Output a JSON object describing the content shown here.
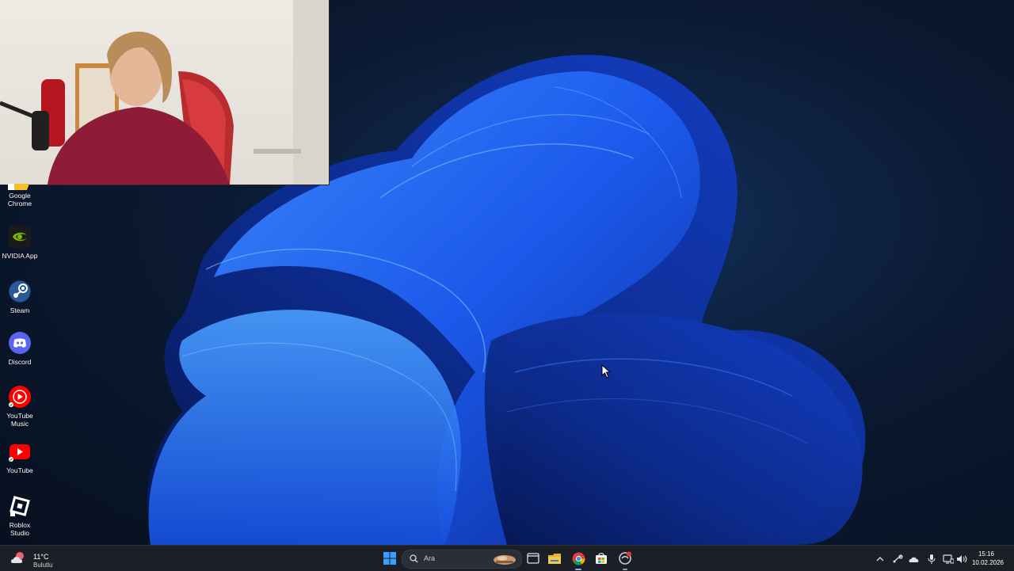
{
  "desktop": {
    "icons": [
      {
        "label_line1": "Google",
        "label_line2": "Chrome",
        "icon": "chrome-icon"
      },
      {
        "label_line1": "NVIDIA App",
        "label_line2": "",
        "icon": "nvidia-icon"
      },
      {
        "label_line1": "Steam",
        "label_line2": "",
        "icon": "steam-icon"
      },
      {
        "label_line1": "Discord",
        "label_line2": "",
        "icon": "discord-icon"
      },
      {
        "label_line1": "YouTube",
        "label_line2": "Music",
        "icon": "youtube-music-icon"
      },
      {
        "label_line1": "YouTube",
        "label_line2": "",
        "icon": "youtube-icon"
      },
      {
        "label_line1": "Roblox",
        "label_line2": "Studio",
        "icon": "roblox-studio-icon"
      }
    ]
  },
  "taskbar": {
    "weather": {
      "temperature": "11°C",
      "condition": "Bulutlu"
    },
    "search": {
      "placeholder": "Ara"
    },
    "apps": [
      "start-icon",
      "search-icon",
      "task-view-icon",
      "file-explorer-icon",
      "chrome-icon",
      "store-icon",
      "antivirus-icon"
    ],
    "tray": [
      "chevron-up-icon",
      "steam-tray-icon",
      "onedrive-icon",
      "microphone-icon",
      "network-icon",
      "volume-icon"
    ],
    "clock": {
      "time": "15:16",
      "date": "10.02.2026"
    }
  },
  "colors": {
    "accent": "#1f6fff",
    "taskbar_bg": "#1c1f26",
    "desktop_bg": "#0b1a33"
  }
}
